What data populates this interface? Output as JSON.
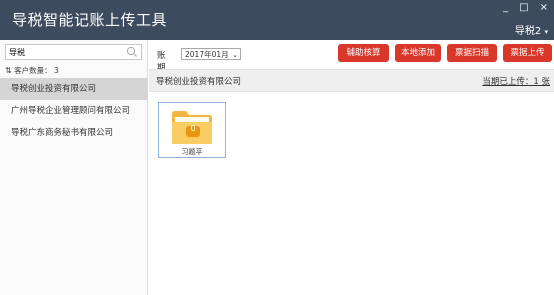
{
  "app": {
    "title": "导税智能记账上传工具",
    "user": "导税2"
  },
  "window_controls": {
    "minimize": "_",
    "maximize": "□",
    "close": "×"
  },
  "sidebar": {
    "search": {
      "value": "导税",
      "icon": "search-icon"
    },
    "count_label": "客户数量：",
    "count_value": "3",
    "clients": [
      {
        "name": "导税创业投资有限公司",
        "selected": true
      },
      {
        "name": "广州导税企业管理顾问有限公司",
        "selected": false
      },
      {
        "name": "导税广东商务秘书有限公司",
        "selected": false
      }
    ]
  },
  "toolbar": {
    "period_label": "账期",
    "period_value": "2017年01月",
    "buttons": [
      "辅助核算",
      "本地添加",
      "票据扫描",
      "票据上传"
    ]
  },
  "main": {
    "company": "导税创业投资有限公司",
    "upload_status": "当期已上传：1 张",
    "folder": {
      "badge": "0",
      "label": "习题平"
    }
  },
  "colors": {
    "titlebar": "#3d4b5f",
    "accent_button": "#d9372a",
    "folder": "#f6c65c",
    "folder_badge": "#e8960f"
  }
}
